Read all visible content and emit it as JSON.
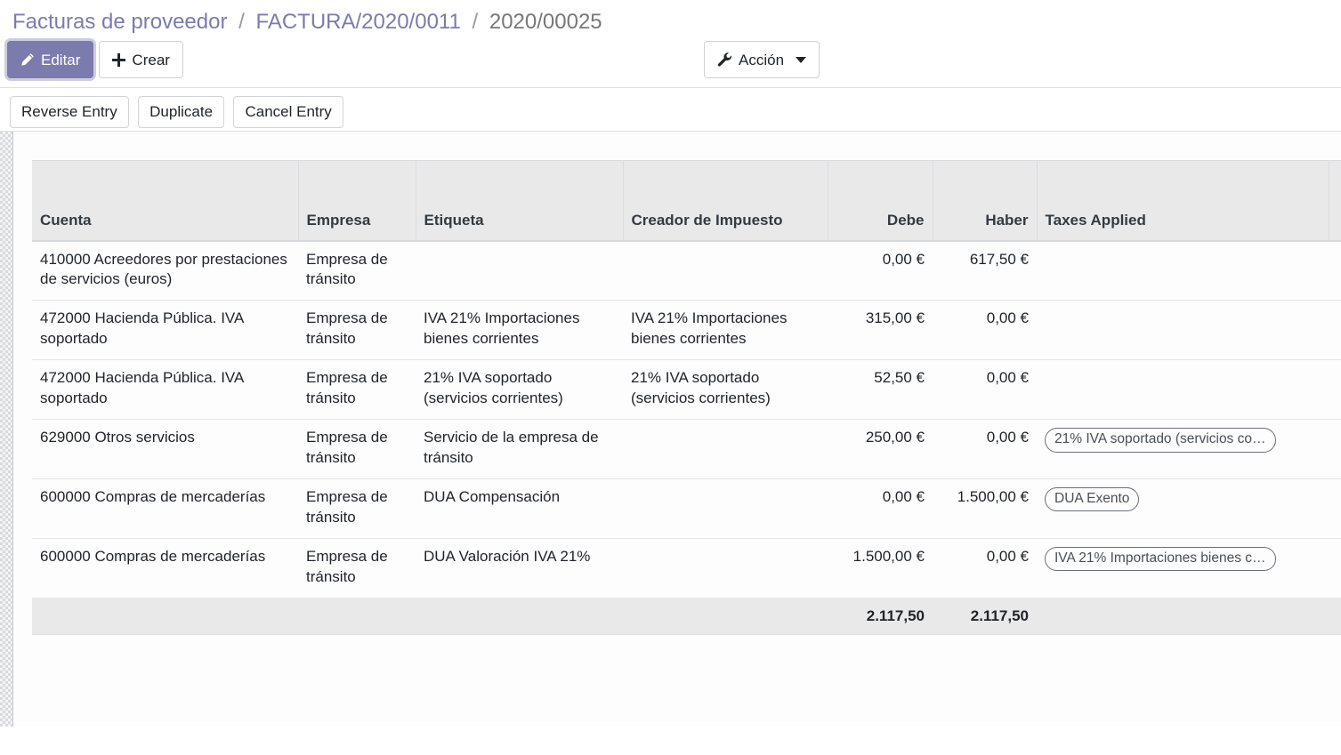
{
  "breadcrumb": {
    "items": [
      {
        "label": "Facturas de proveedor",
        "current": false
      },
      {
        "label": "FACTURA/2020/0011",
        "current": false
      },
      {
        "label": "2020/00025",
        "current": true
      }
    ],
    "separator": "/"
  },
  "toolbar": {
    "edit_label": "Editar",
    "create_label": "Crear",
    "action_label": "Acción",
    "edit_icon": "pencil-icon",
    "create_icon": "plus-icon",
    "action_icon": "wrench-icon",
    "caret_icon": "caret-down-icon",
    "primary_color": "#7c7bad"
  },
  "statusbar": {
    "buttons": [
      {
        "label": "Reverse Entry"
      },
      {
        "label": "Duplicate"
      },
      {
        "label": "Cancel Entry"
      }
    ]
  },
  "table": {
    "columns": [
      {
        "key": "cuenta",
        "label": "Cuenta",
        "align": "left"
      },
      {
        "key": "empresa",
        "label": "Empresa",
        "align": "left"
      },
      {
        "key": "etiqueta",
        "label": "Etiqueta",
        "align": "left"
      },
      {
        "key": "creador",
        "label": "Creador de Impuesto",
        "align": "left"
      },
      {
        "key": "debe",
        "label": "Debe",
        "align": "right"
      },
      {
        "key": "haber",
        "label": "Haber",
        "align": "right"
      },
      {
        "key": "taxes",
        "label": "Taxes Applied",
        "align": "left"
      },
      {
        "key": "extra",
        "label": "",
        "align": "left"
      }
    ],
    "rows": [
      {
        "cuenta": "410000 Acreedores por prestaciones de servicios (euros)",
        "empresa": "Empresa de tránsito",
        "etiqueta": "",
        "creador": "",
        "debe": "0,00 €",
        "haber": "617,50 €",
        "taxes": ""
      },
      {
        "cuenta": "472000 Hacienda Pública. IVA soportado",
        "empresa": "Empresa de tránsito",
        "etiqueta": "IVA 21% Importaciones bienes corrientes",
        "creador": "IVA 21% Importaciones bienes corrientes",
        "debe": "315,00 €",
        "haber": "0,00 €",
        "taxes": ""
      },
      {
        "cuenta": "472000 Hacienda Pública. IVA soportado",
        "empresa": "Empresa de tránsito",
        "etiqueta": "21% IVA soportado (servicios corrientes)",
        "creador": "21% IVA soportado (servicios corrientes)",
        "debe": "52,50 €",
        "haber": "0,00 €",
        "taxes": ""
      },
      {
        "cuenta": "629000 Otros servicios",
        "empresa": "Empresa de tránsito",
        "etiqueta": "Servicio de la empresa de tránsito",
        "creador": "",
        "debe": "250,00 €",
        "haber": "0,00 €",
        "taxes": "21% IVA soportado (servicios co…"
      },
      {
        "cuenta": "600000 Compras de mercaderías",
        "empresa": "Empresa de tránsito",
        "etiqueta": "DUA Compensación",
        "creador": "",
        "debe": "0,00 €",
        "haber": "1.500,00 €",
        "taxes": "DUA Exento"
      },
      {
        "cuenta": "600000 Compras de mercaderías",
        "empresa": "Empresa de tránsito",
        "etiqueta": "DUA Valoración IVA 21%",
        "creador": "",
        "debe": "1.500,00 €",
        "haber": "0,00 €",
        "taxes": "IVA 21% Importaciones bienes c…"
      }
    ],
    "totals": {
      "debe": "2.117,50",
      "haber": "2.117,50"
    }
  }
}
